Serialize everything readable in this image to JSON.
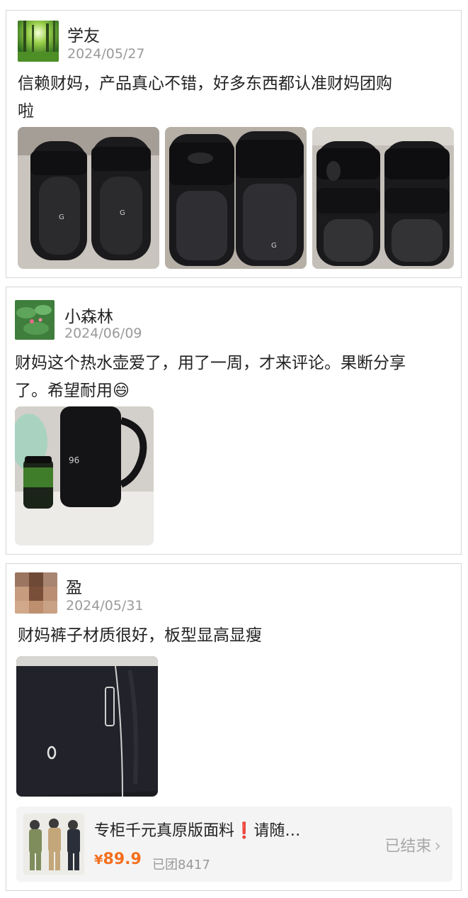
{
  "reviews": [
    {
      "name": "学友",
      "date": "2024/05/27",
      "text_line1": "信赖财妈，产品真心不错，好多东西都认准财妈团购",
      "text_line2": "啦"
    },
    {
      "name": "小森林",
      "date": "2024/06/09",
      "text_line1": "财妈这个热水壶爱了，用了一周，才来评论。果断分享",
      "text_line2": "了。希望耐用😄"
    },
    {
      "name": "盈",
      "date": "2024/05/31",
      "text_line1": "财妈裤子材质很好，板型显高显瘦"
    }
  ],
  "product": {
    "title": "专柜千元真原版面料",
    "title_warn": "❗",
    "title_suffix": "请随…",
    "price_symbol": "¥",
    "price": "89.9",
    "sold": "已团8417",
    "status": "已结束",
    "status_icon": "›"
  }
}
